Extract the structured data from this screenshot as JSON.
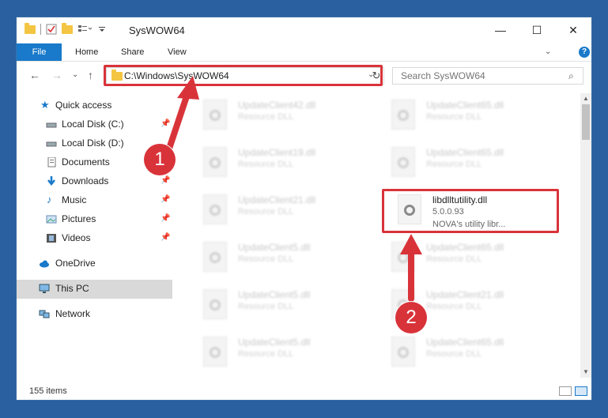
{
  "window": {
    "title": "SysWOW64",
    "minimize_glyph": "—",
    "maximize_glyph": "☐",
    "close_glyph": "✕"
  },
  "ribbon": {
    "tabs": [
      "File",
      "Home",
      "Share",
      "View"
    ],
    "help_glyph": "?",
    "expand_glyph": "⌄"
  },
  "nav": {
    "back_glyph": "←",
    "forward_glyph": "→",
    "recent_glyph": "⌄",
    "up_glyph": "↑"
  },
  "address": {
    "path": "C:\\Windows\\SysWOW64",
    "dropdown_glyph": "⌄",
    "refresh_glyph": "↻"
  },
  "search": {
    "placeholder": "Search SysWOW64",
    "icon_glyph": "⌕"
  },
  "navpane": {
    "items": [
      {
        "label": "Quick access",
        "icon": "star-icon",
        "pinned": false
      },
      {
        "label": "Local Disk (C:)",
        "icon": "drive-icon",
        "pinned": true
      },
      {
        "label": "Local Disk (D:)",
        "icon": "drive-icon",
        "pinned": false
      },
      {
        "label": "Documents",
        "icon": "documents-icon",
        "pinned": true
      },
      {
        "label": "Downloads",
        "icon": "download-icon",
        "pinned": true
      },
      {
        "label": "Music",
        "icon": "music-icon",
        "pinned": true
      },
      {
        "label": "Pictures",
        "icon": "pictures-icon",
        "pinned": true
      },
      {
        "label": "Videos",
        "icon": "videos-icon",
        "pinned": true
      },
      {
        "label": "OneDrive",
        "icon": "cloud-icon",
        "pinned": false
      },
      {
        "label": "This PC",
        "icon": "computer-icon",
        "pinned": false,
        "selected": true
      },
      {
        "label": "Network",
        "icon": "network-icon",
        "pinned": false
      }
    ]
  },
  "files": {
    "left_column": [
      {
        "name": "UpdateClient42.dll",
        "sub": "Resource DLL"
      },
      {
        "name": "UpdateClient19.dll",
        "sub": "Resource DLL"
      },
      {
        "name": "UpdateClient21.dll",
        "sub": "Resource DLL"
      },
      {
        "name": "UpdateClient5.dll",
        "sub": "Resource DLL"
      },
      {
        "name": "UpdateClient5.dll",
        "sub": "Resource DLL"
      },
      {
        "name": "UpdateClient5.dll",
        "sub": "Resource DLL"
      }
    ],
    "right_column": [
      {
        "name": "UpdateClient65.dll",
        "sub": "Resource DLL"
      },
      {
        "name": "UpdateClient65.dll",
        "sub": "Resource DLL"
      },
      {
        "name": "UpdateClient65.dll",
        "sub": "Resource DLL"
      },
      {
        "name": "UpdateClient21.dll",
        "sub": "Resource DLL"
      },
      {
        "name": "UpdateClient65.dll",
        "sub": "Resource DLL"
      }
    ],
    "highlighted": {
      "name": "libdlltutility.dll",
      "version": "5.0.0.93",
      "description": "NOVA's utility libr..."
    }
  },
  "status": {
    "item_count": "155 items"
  },
  "callouts": [
    "1",
    "2"
  ],
  "colors": {
    "accent": "#1979ca",
    "highlight": "#d9333a",
    "desktop": "#2a5fa0"
  }
}
